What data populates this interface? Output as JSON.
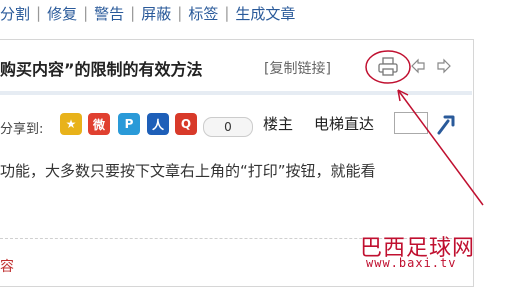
{
  "toolbar": {
    "items": [
      "分割",
      "修复",
      "警告",
      "屏蔽",
      "标签",
      "生成文章"
    ],
    "separator": "|"
  },
  "post": {
    "title": "购买内容”的限制的有效方法",
    "copy_link_label": "[复制链接]",
    "share_label": "分享到:",
    "share_count": "0",
    "louzhu_label": "楼主",
    "elevator_label": "电梯直达",
    "body_line": "功能，大多数只要按下文章右上角的“打印”按钮，就能看",
    "bottom_text": "容"
  },
  "share_icons": [
    {
      "name": "qzone-icon",
      "glyph": "★"
    },
    {
      "name": "weibo-icon",
      "glyph": "微"
    },
    {
      "name": "tencent-weibo-icon",
      "glyph": "P"
    },
    {
      "name": "renren-icon",
      "glyph": "人"
    },
    {
      "name": "qq-icon",
      "glyph": "Q"
    }
  ],
  "watermark": {
    "title": "巴西足球网",
    "url": "www.baxi.tv"
  },
  "colors": {
    "toolbar_link": "#2a5a9a",
    "annotation": "#c01030",
    "panel_border": "#d6d6d6"
  }
}
